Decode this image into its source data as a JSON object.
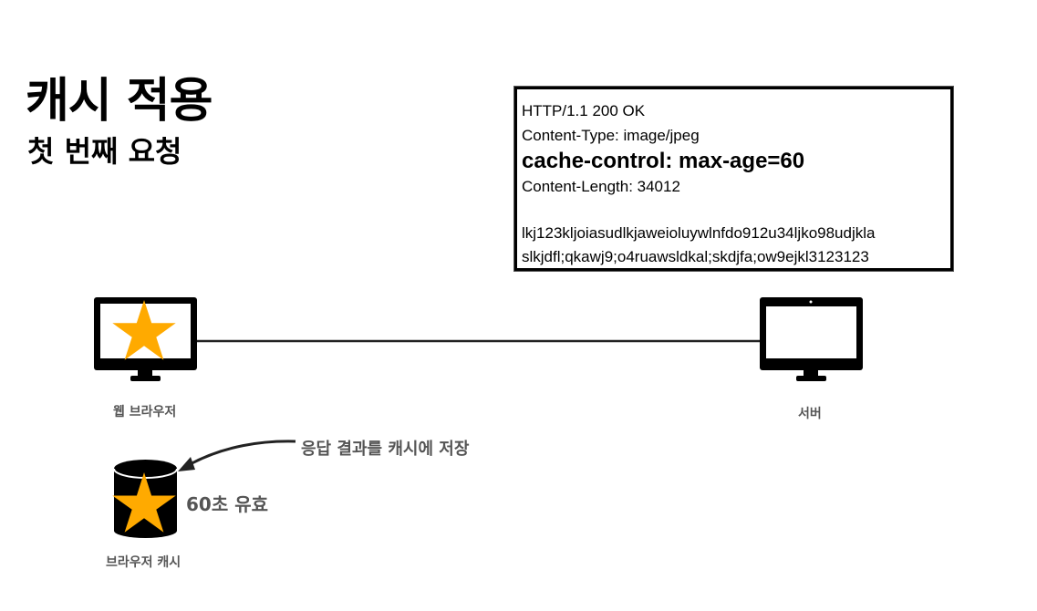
{
  "slide": {
    "title": "캐시 적용",
    "subtitle": "첫 번째 요청"
  },
  "http_response": {
    "status_line": "HTTP/1.1 200 OK",
    "content_type": "Content-Type: image/jpeg",
    "cache_control": "cache-control: max-age=60",
    "content_length": "Content-Length: 34012",
    "body_line_1": "lkj123kljoiasudlkjaweioluywlnfdo912u34ljko98udjkla",
    "body_line_2": "slkjdfl;qkawj9;o4ruawsldkal;skdjfa;ow9ejkl3123123"
  },
  "nodes": {
    "client_label": "웹 브라우저",
    "server_label": "서버",
    "cache_label": "브라우저 캐시"
  },
  "annotations": {
    "store_note": "응답 결과를 캐시에 저장",
    "validity": "60초 유효"
  },
  "colors": {
    "star": "#FFAA00",
    "device": "#000000",
    "label_gray": "#555555"
  }
}
